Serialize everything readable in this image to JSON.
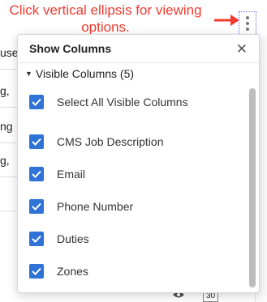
{
  "annotation": {
    "text": "Click vertical ellipsis for viewing options."
  },
  "background": {
    "row_texts": [
      "use",
      "g,",
      "ng",
      "g,",
      ""
    ],
    "footer_badge": "30"
  },
  "popover": {
    "title": "Show Columns",
    "section_title": "Visible Columns (5)",
    "items": [
      {
        "label": "Select All Visible Columns",
        "checked": true
      },
      {
        "label": "CMS Job Description",
        "checked": true
      },
      {
        "label": "Email",
        "checked": true
      },
      {
        "label": "Phone Number",
        "checked": true
      },
      {
        "label": "Duties",
        "checked": true
      },
      {
        "label": "Zones",
        "checked": true
      }
    ]
  },
  "colors": {
    "accent": "#2f73d6",
    "annotation": "#ee3a2f"
  },
  "icons": [
    "vertical-ellipsis-icon",
    "close-icon",
    "caret-down-icon",
    "checkmark-icon",
    "eye-icon",
    "arrow-icon"
  ]
}
